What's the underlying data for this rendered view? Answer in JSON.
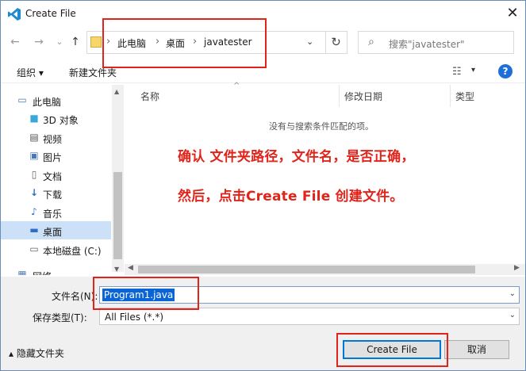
{
  "window": {
    "title": "Create File",
    "close_glyph": "✕"
  },
  "nav": {
    "back": "←",
    "forward": "→",
    "dropdown": "⌄",
    "up": "↑"
  },
  "address": {
    "crumbs": [
      "此电脑",
      "桌面",
      "javatester"
    ],
    "separator": "›",
    "dropdown": "⌄",
    "refresh": "↻"
  },
  "search": {
    "placeholder": "搜索\"javatester\"",
    "icon": "⌕"
  },
  "toolbar": {
    "organize": "组织 ▾",
    "new_folder": "新建文件夹",
    "view_icon": "☷",
    "view_dd": "▾",
    "help": "?"
  },
  "sidebar": {
    "items": [
      {
        "label": "此电脑",
        "icon": "computer-icon",
        "glyph": "▭"
      },
      {
        "label": "3D 对象",
        "icon": "cube-icon",
        "glyph": "■"
      },
      {
        "label": "视频",
        "icon": "video-icon",
        "glyph": "▤"
      },
      {
        "label": "图片",
        "icon": "picture-icon",
        "glyph": "▣"
      },
      {
        "label": "文档",
        "icon": "document-icon",
        "glyph": "▯"
      },
      {
        "label": "下载",
        "icon": "download-icon",
        "glyph": "↓"
      },
      {
        "label": "音乐",
        "icon": "music-icon",
        "glyph": "♪"
      },
      {
        "label": "桌面",
        "icon": "desktop-icon",
        "glyph": "▬"
      },
      {
        "label": "本地磁盘 (C:)",
        "icon": "disk-icon",
        "glyph": "▭"
      },
      {
        "label": "网络",
        "icon": "network-icon",
        "glyph": "▦"
      }
    ],
    "selected_index": 7
  },
  "filelist": {
    "columns": [
      "名称",
      "修改日期",
      "类型"
    ],
    "empty_message": "没有与搜索条件匹配的项。",
    "sort_glyph": "^"
  },
  "annotation": {
    "line1": "确认 文件夹路径，文件名，是否正确，",
    "line2": "然后，点击Create File 创建文件。",
    "color": "#e2231a"
  },
  "form": {
    "filename_label": "文件名(N):",
    "filename_value": "Program1.java",
    "type_label": "保存类型(T):",
    "type_value": "All Files (*.*)",
    "dropdown": "⌄"
  },
  "footer": {
    "hide_folders": "▴ 隐藏文件夹",
    "create_button": "Create File",
    "cancel_button": "取消"
  }
}
